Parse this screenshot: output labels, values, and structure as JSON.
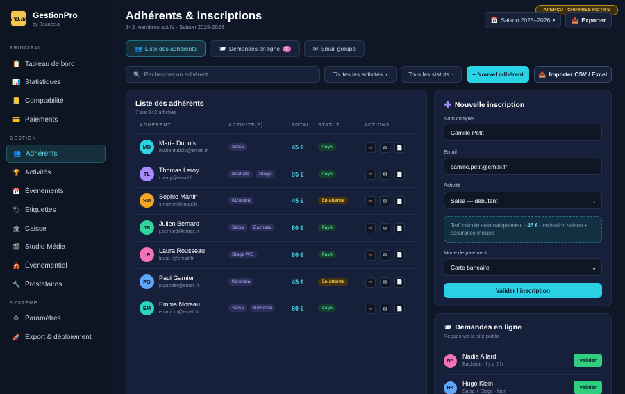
{
  "brand": {
    "logo": "PB.ai",
    "name": "GestionPro",
    "sub": "by Beauce.ai"
  },
  "sidebar": {
    "sections": [
      {
        "label": "PRINCIPAL",
        "items": [
          {
            "label": "Tableau de bord",
            "icon": "📋",
            "icon_name": "clipboard-icon"
          },
          {
            "label": "Statistiques",
            "icon": "📊",
            "icon_name": "bar-chart-icon"
          },
          {
            "label": "Comptabilité",
            "icon": "📒",
            "icon_name": "ledger-icon"
          },
          {
            "label": "Paiements",
            "icon": "💳",
            "icon_name": "credit-card-icon"
          }
        ]
      },
      {
        "label": "GESTION",
        "items": [
          {
            "label": "Adhérents",
            "icon": "👥",
            "icon_name": "users-icon",
            "active": true
          },
          {
            "label": "Activités",
            "icon": "🏆",
            "icon_name": "trophy-icon"
          },
          {
            "label": "Événements",
            "icon": "📅",
            "icon_name": "calendar-icon"
          },
          {
            "label": "Étiquettes",
            "icon": "🏷",
            "icon_name": "tag-icon"
          },
          {
            "label": "Caisse",
            "icon": "🏛",
            "icon_name": "bank-icon"
          },
          {
            "label": "Studio Média",
            "icon": "🎬",
            "icon_name": "media-icon"
          },
          {
            "label": "Événementiel",
            "icon": "🎪",
            "icon_name": "circus-tent-icon"
          },
          {
            "label": "Prestataires",
            "icon": "🔧",
            "icon_name": "wrench-icon"
          }
        ]
      },
      {
        "label": "SYSTÈME",
        "items": [
          {
            "label": "Paramètres",
            "icon": "⚙",
            "icon_name": "gear-icon"
          },
          {
            "label": "Export & déploiement",
            "icon": "🚀",
            "icon_name": "rocket-icon"
          }
        ]
      }
    ]
  },
  "header": {
    "title": "Adhérents & inscriptions",
    "subtitle": "142 membres actifs · Saison 2025-2026",
    "preview_badge": "APERÇU · CHIFFRES FICTIFS",
    "season_select": "Saison 2025–2026",
    "export_button": "Exporter"
  },
  "tabs": [
    {
      "label": "Liste des adhérents",
      "icon": "👥"
    },
    {
      "label": "Demandes en ligne",
      "icon": "📨",
      "count": "3"
    },
    {
      "label": "Email groupé",
      "icon": "✉"
    }
  ],
  "toolbar": {
    "search_placeholder": "Rechercher un adhérent...",
    "filter_activities": "Toutes les activités",
    "filter_status": "Tous les statuts",
    "new_member": "+ Nouvel adhérent",
    "import": "Importer CSV / Excel"
  },
  "members_table": {
    "title": "Liste des adhérents",
    "subtitle": "7 sur 142 affichés",
    "columns": [
      "ADHÉRENT",
      "ACTIVITÉ(S)",
      "TOTAL",
      "STATUT",
      "ACTIONS"
    ],
    "rows": [
      {
        "initials": "MD",
        "color": "#2dd4e0",
        "name": "Marie Dubois",
        "email": "marie.dubois@email.fr",
        "activities": [
          "Salsa"
        ],
        "total": "45 €",
        "status": "Payé",
        "status_kind": "paid"
      },
      {
        "initials": "TL",
        "color": "#a78bfa",
        "name": "Thomas Leroy",
        "email": "t.leroy@email.fr",
        "activities": [
          "Bachata",
          "Stage"
        ],
        "total": "95 €",
        "status": "Payé",
        "status_kind": "paid"
      },
      {
        "initials": "SM",
        "color": "#f5a524",
        "name": "Sophie Martin",
        "email": "s.martin@email.fr",
        "activities": [
          "Kizomba"
        ],
        "total": "45 €",
        "status": "En attente",
        "status_kind": "pending"
      },
      {
        "initials": "JB",
        "color": "#34d399",
        "name": "Julien Bernard",
        "email": "j.bernard@email.fr",
        "activities": [
          "Salsa",
          "Bachata"
        ],
        "total": "80 €",
        "status": "Payé",
        "status_kind": "paid"
      },
      {
        "initials": "LR",
        "color": "#f472b6",
        "name": "Laura Rousseau",
        "email": "laura.r@email.fr",
        "activities": [
          "Stage WE"
        ],
        "total": "60 €",
        "status": "Payé",
        "status_kind": "paid"
      },
      {
        "initials": "PG",
        "color": "#60a5fa",
        "name": "Paul Garnier",
        "email": "p.garnier@email.fr",
        "activities": [
          "Kizomba"
        ],
        "total": "45 €",
        "status": "En attente",
        "status_kind": "pending"
      },
      {
        "initials": "EM",
        "color": "#2dd4bf",
        "name": "Emma Moreau",
        "email": "emma.m@email.fr",
        "activities": [
          "Salsa",
          "Kizomba"
        ],
        "total": "80 €",
        "status": "Payé",
        "status_kind": "paid"
      }
    ],
    "action_icons": [
      "✏",
      "✉",
      "📄"
    ]
  },
  "registration_form": {
    "title": "Nouvelle inscription",
    "full_name_label": "Nom complet",
    "full_name_value": "Camille Petit",
    "email_label": "Email",
    "email_value": "camille.petit@email.fr",
    "activity_label": "Activité",
    "activity_value": "Salsa — débutant",
    "info_prefix": "Tarif calculé automatiquement · ",
    "info_amount": "45 €",
    "info_suffix": " · cotisation saison + assurance incluse",
    "payment_label": "Mode de paiement",
    "payment_value": "Carte bancaire",
    "submit": "Valider l'inscription"
  },
  "online_requests": {
    "title": "Demandes en ligne",
    "subtitle": "Reçues via le site public",
    "items": [
      {
        "initials": "NA",
        "color": "#f472b6",
        "name": "Nadia Allard",
        "meta": "Bachata · il y a 2 h",
        "button": "Valider"
      },
      {
        "initials": "HK",
        "color": "#60a5fa",
        "name": "Hugo Klein",
        "meta": "Salsa + Stage · hier",
        "button": "Valider"
      }
    ]
  }
}
